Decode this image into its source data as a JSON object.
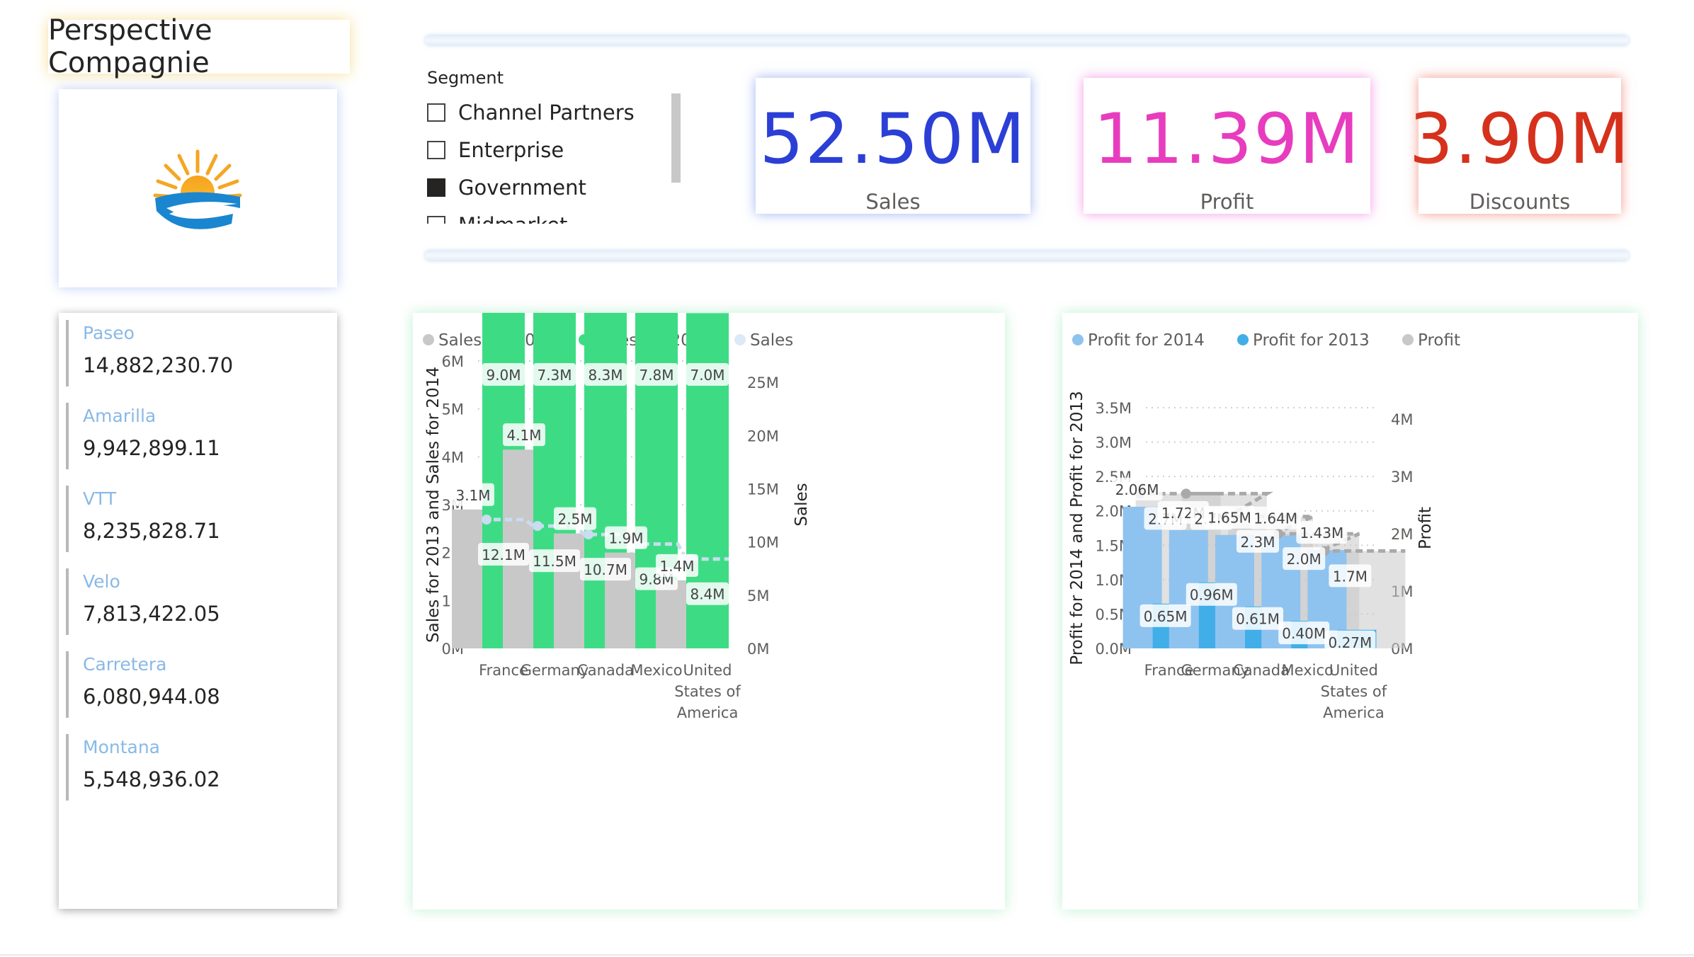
{
  "title": "Perspective Compagnie",
  "product_list": [
    {
      "label": "Paseo",
      "value": "14,882,230.70"
    },
    {
      "label": "Amarilla",
      "value": "9,942,899.11"
    },
    {
      "label": "VTT",
      "value": "8,235,828.71"
    },
    {
      "label": "Velo",
      "value": "7,813,422.05"
    },
    {
      "label": "Carretera",
      "value": "6,080,944.08"
    },
    {
      "label": "Montana",
      "value": "5,548,936.02"
    }
  ],
  "slicer": {
    "title": "Segment",
    "items": [
      {
        "label": "Channel Partners",
        "checked": false
      },
      {
        "label": "Enterprise",
        "checked": false
      },
      {
        "label": "Government",
        "checked": true
      },
      {
        "label": "Midmarket",
        "checked": false
      }
    ]
  },
  "kpis": {
    "sales": {
      "value": "52.50M",
      "label": "Sales",
      "color": "#2b3fd6"
    },
    "profit": {
      "value": "11.39M",
      "label": "Profit",
      "color": "#e83cbf"
    },
    "discounts": {
      "value": "3.90M",
      "label": "Discounts",
      "color": "#d6311c"
    }
  },
  "chart_data": [
    {
      "type": "bar",
      "categories": [
        "France",
        "Germany",
        "Canada",
        "Mexico",
        "United States of America"
      ],
      "legend": [
        "Sales for 2013",
        "Sales for 2014",
        "Sales"
      ],
      "legend_placement": "top-left",
      "series": [
        {
          "name": "Sales for 2013",
          "axis": "left",
          "color": "#c8c8c8",
          "values": [
            2.9,
            4.15,
            2.4,
            2.0,
            1.42
          ],
          "labels": [
            "3.1M",
            "4.1M",
            "2.5M",
            "1.9M",
            "1.4M"
          ]
        },
        {
          "name": "Sales for 2014",
          "axis": "left",
          "color": "#3ddc84",
          "values": [
            9.0,
            7.3,
            8.3,
            7.8,
            7.0
          ],
          "labels": [
            "9.0M",
            "7.3M",
            "8.3M",
            "7.8M",
            "7.0M"
          ]
        },
        {
          "name": "Sales",
          "axis": "right",
          "color": "#dce9f7",
          "values": [
            12.1,
            11.5,
            10.7,
            9.8,
            8.4
          ],
          "labels": [
            "12.1M",
            "11.5M",
            "10.7M",
            "9.8M",
            "8.4M"
          ]
        }
      ],
      "ylabel": "Sales for 2013 and Sales for 2014",
      "y2label": "Sales",
      "ylim": [
        0,
        6
      ],
      "y2lim": [
        0,
        27
      ],
      "yticks": [
        "0M",
        "1M",
        "2M",
        "3M",
        "4M",
        "5M",
        "6M"
      ],
      "y2ticks": [
        "0M",
        "5M",
        "10M",
        "15M",
        "20M",
        "25M"
      ],
      "grid": true
    },
    {
      "type": "bar",
      "categories": [
        "France",
        "Germany",
        "Canada",
        "Mexico",
        "United States of America"
      ],
      "legend": [
        "Profit for 2014",
        "Profit for 2013",
        "Profit"
      ],
      "legend_placement": "top-left",
      "series": [
        {
          "name": "Profit for 2014",
          "axis": "left",
          "color": "#8fc3ef",
          "values": [
            2.06,
            1.72,
            1.65,
            1.64,
            1.43
          ],
          "labels": [
            "2.06M",
            "1.72M",
            "1.65M",
            "1.64M",
            "1.43M"
          ]
        },
        {
          "name": "Profit for 2013",
          "axis": "left",
          "color": "#41aee8",
          "values": [
            0.65,
            0.96,
            0.61,
            0.4,
            0.27
          ],
          "labels": [
            "0.65M",
            "0.96M",
            "0.61M",
            "0.40M",
            "0.27M"
          ]
        },
        {
          "name": "Profit",
          "axis": "right",
          "color": "#c8c8c8",
          "values": [
            2.7,
            2.7,
            2.3,
            2.0,
            1.7
          ],
          "labels": [
            "2.7M",
            "2.7M",
            "2.3M",
            "2.0M",
            "1.7M"
          ]
        }
      ],
      "ylabel": "Profit for 2014 and Profit for 2013",
      "y2label": "Profit",
      "ylim": [
        0,
        3.5
      ],
      "y2lim": [
        0,
        4.2
      ],
      "yticks": [
        "0.0M",
        "0.5M",
        "1.0M",
        "1.5M",
        "2.0M",
        "2.5M",
        "3.0M",
        "3.5M"
      ],
      "y2ticks": [
        "0M",
        "1M",
        "2M",
        "3M",
        "4M"
      ],
      "grid": true
    }
  ]
}
